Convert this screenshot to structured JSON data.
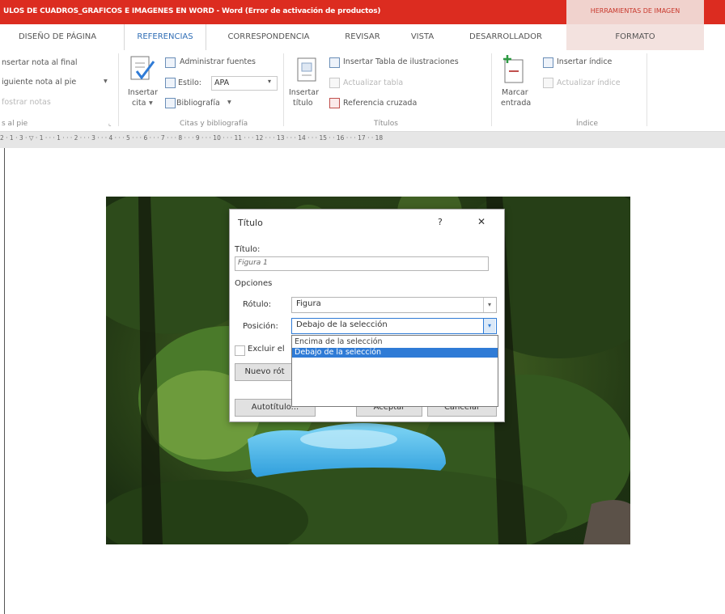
{
  "window": {
    "title": "ULOS DE CUADROS_GRAFICOS E IMAGENES EN WORD - Word (Error de activación de productos)",
    "contextual_group": "HERRAMIENTAS DE IMAGEN"
  },
  "tabs": [
    {
      "label": "DISEÑO DE PÁGINA"
    },
    {
      "label": "REFERENCIAS"
    },
    {
      "label": "CORRESPONDENCIA"
    },
    {
      "label": "REVISAR"
    },
    {
      "label": "VISTA"
    },
    {
      "label": "DESARROLLADOR"
    },
    {
      "label": "FORMATO"
    }
  ],
  "ribbon": {
    "footnotes": {
      "insert_endnote": "nsertar nota al final",
      "next_footnote": "iguiente nota al pie",
      "show_notes": "fostrar notas",
      "group_label": "s al pie"
    },
    "citations": {
      "insert_citation_1": "Insertar",
      "insert_citation_2": "cita",
      "manage_sources": "Administrar fuentes",
      "style_label": "Estilo:",
      "style_value": "APA",
      "bibliography": "Bibliografía",
      "group_label": "Citas y bibliografía"
    },
    "captions": {
      "insert_caption_1": "Insertar",
      "insert_caption_2": "título",
      "insert_table_figures": "Insertar Tabla de ilustraciones",
      "update_table": "Actualizar tabla",
      "cross_reference": "Referencia cruzada",
      "group_label": "Títulos"
    },
    "index": {
      "mark_entry_1": "Marcar",
      "mark_entry_2": "entrada",
      "insert_index": "Insertar índice",
      "update_index": "Actualizar índice",
      "group_label": "Índice"
    }
  },
  "ruler": {
    "ticks": "2 · 1 · 3 · ▽ · 1 · · · 1 · · · 2 · · · 3 · · · 4 · · · 5 · · · 6 · · · 7 · · · 8 · · · 9 · · · 10 · · · 11 · · · 12 · · · 13 · · · 14 · · · 15 · · 16 · · · 17 · · 18"
  },
  "dialog": {
    "title": "Título",
    "help": "?",
    "close": "✕",
    "caption_label": "Título:",
    "caption_value": "Figura 1",
    "options_heading": "Opciones",
    "label_label": "Rótulo:",
    "label_value": "Figura",
    "position_label": "Posición:",
    "position_value": "Debajo de la selección",
    "exclude_label": "Excluir el",
    "new_label_button": "Nuevo rót",
    "autocaption_button": "Autotítulo...",
    "ok_button": "Aceptar",
    "cancel_button": "Cancelar",
    "position_options": [
      {
        "label": "Encima de la selección",
        "selected": false
      },
      {
        "label": "Debajo de la selección",
        "selected": true
      }
    ]
  }
}
